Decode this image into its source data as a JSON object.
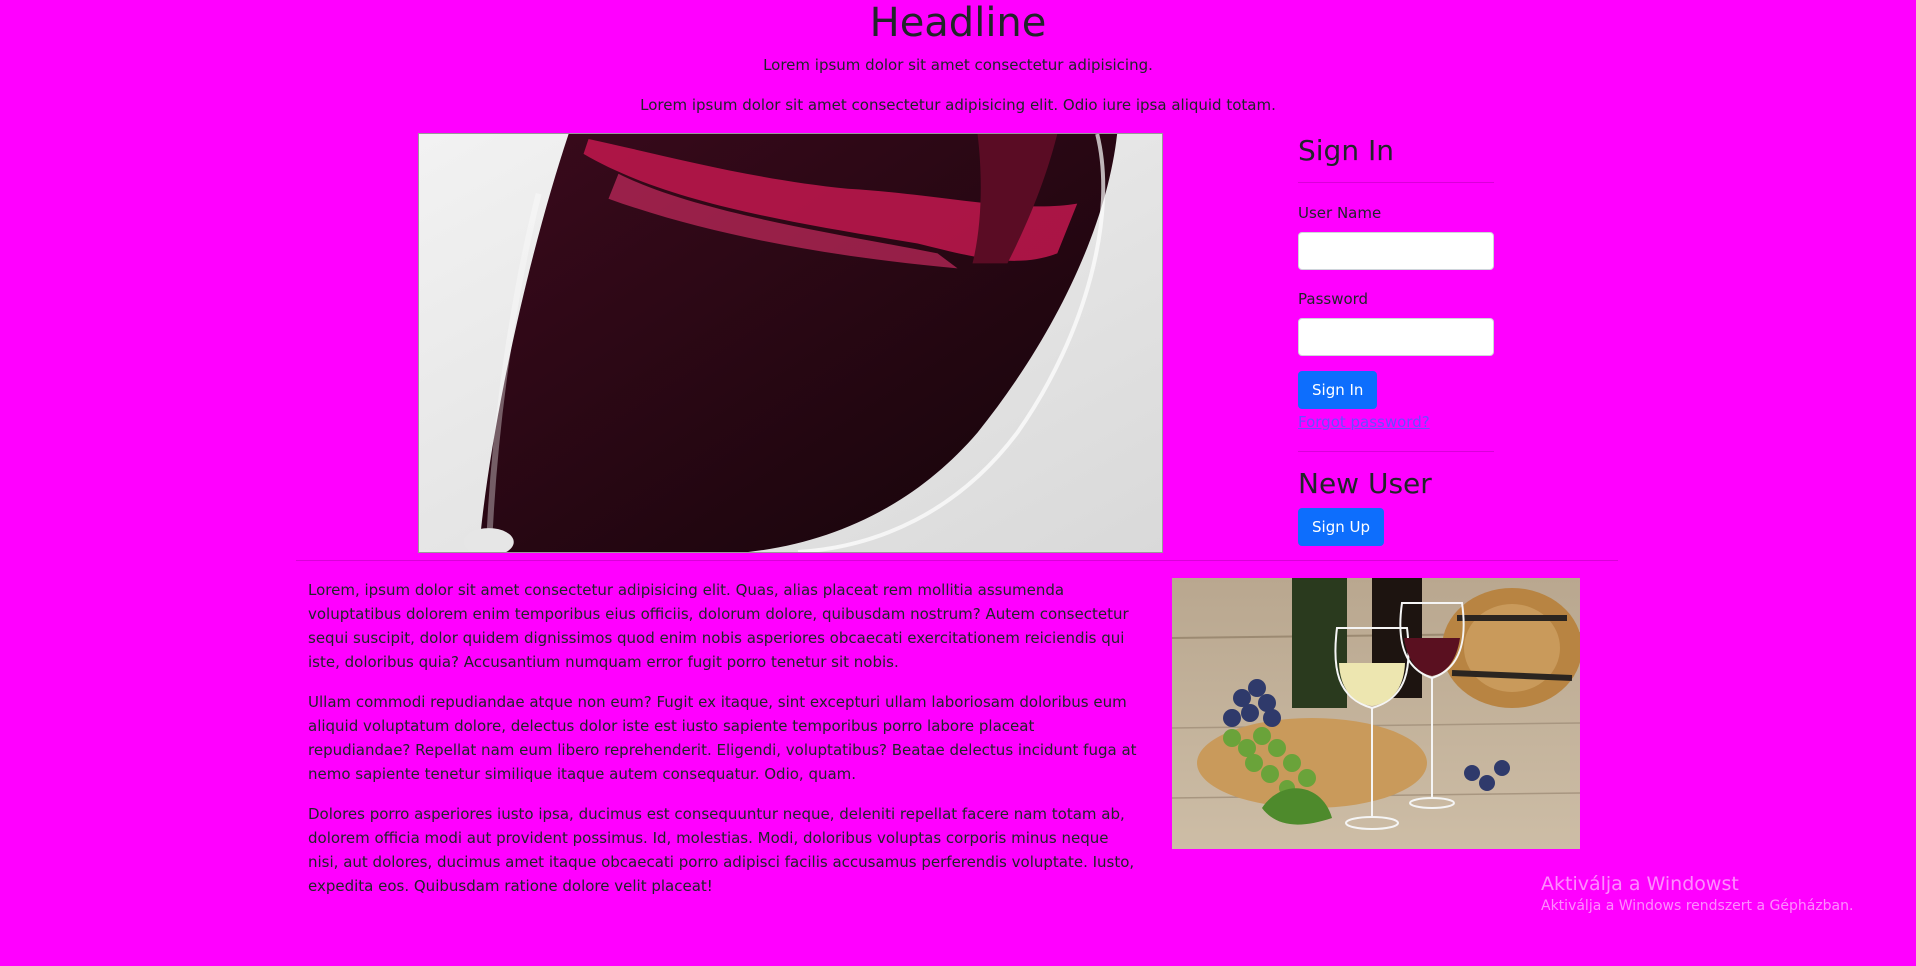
{
  "header": {
    "title": "Headline",
    "subtitle1": "Lorem ipsum dolor sit amet consectetur adipisicing.",
    "subtitle2": "Lorem ipsum dolor sit amet consectetur adipisicing elit. Odio iure ipsa aliquid totam."
  },
  "signin": {
    "title": "Sign In",
    "username_label": "User Name",
    "username_value": "",
    "password_label": "Password",
    "password_value": "",
    "button_label": "Sign In",
    "forgot_link": "Forgot password?"
  },
  "newuser": {
    "title": "New User",
    "button_label": "Sign Up"
  },
  "content": {
    "paragraphs": [
      "Lorem, ipsum dolor sit amet consectetur adipisicing elit. Quas, alias placeat rem mollitia assumenda voluptatibus dolorem enim temporibus eius officiis, dolorum dolore, quibusdam nostrum? Autem consectetur sequi suscipit, dolor quidem dignissimos quod enim nobis asperiores obcaecati exercitationem reiciendis qui iste, doloribus quia? Accusantium numquam error fugit porro tenetur sit nobis.",
      "Ullam commodi repudiandae atque non eum? Fugit ex itaque, sint excepturi ullam laboriosam doloribus eum aliquid voluptatum dolore, delectus dolor iste est iusto sapiente temporibus porro labore placeat repudiandae? Repellat nam eum libero reprehenderit. Eligendi, voluptatibus? Beatae delectus incidunt fuga at nemo sapiente tenetur similique itaque autem consequatur. Odio, quam.",
      "Dolores porro asperiores iusto ipsa, ducimus est consequuntur neque, deleniti repellat facere nam totam ab, dolorem officia modi aut provident possimus. Id, molestias. Modi, doloribus voluptas corporis minus neque nisi, aut dolores, ducimus amet itaque obcaecati porro adipisci facilis accusamus perferendis voluptate. Iusto, expedita eos. Quibusdam ratione dolore velit placeat!"
    ]
  },
  "watermark": {
    "title": "Aktiválja a Windowst",
    "subtitle": "Aktiválja a Windows rendszert a Gépházban."
  },
  "colors": {
    "background": "#ff00ff",
    "button": "#0d6efd",
    "link": "#6a4cff"
  }
}
